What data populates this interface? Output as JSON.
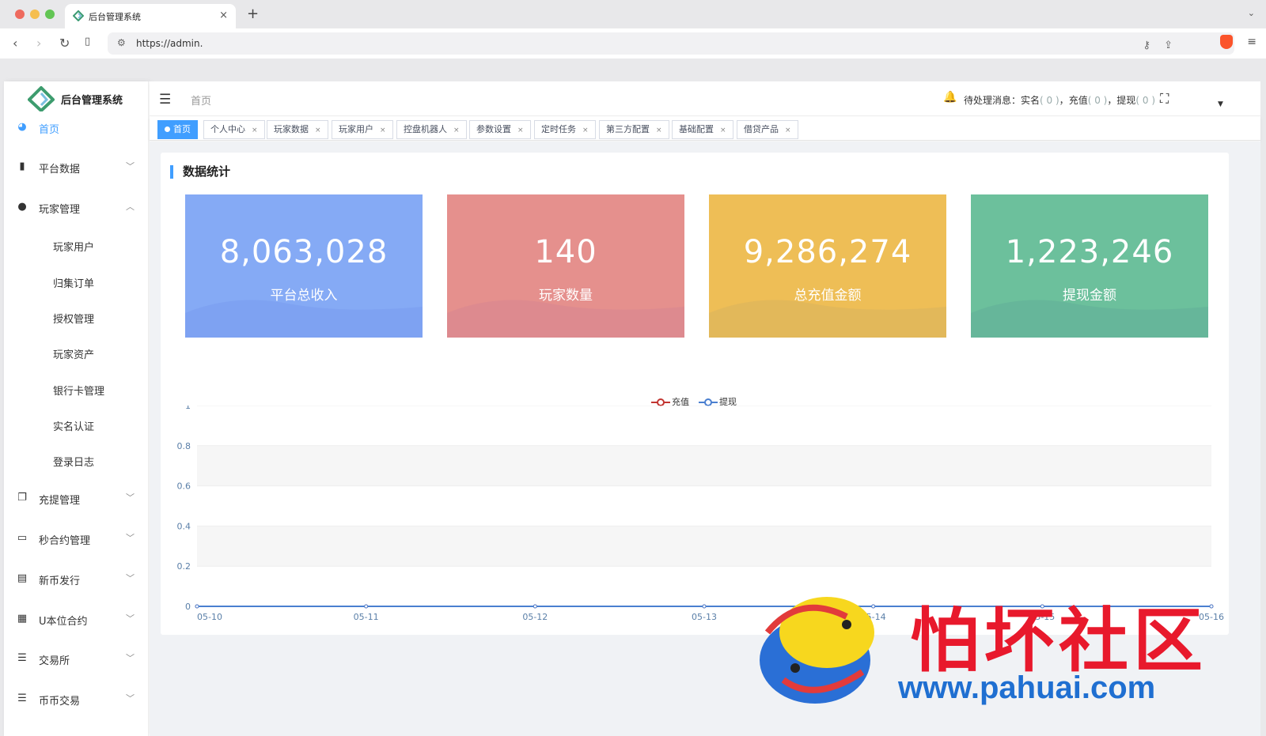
{
  "browser": {
    "tab_title": "后台管理系统",
    "new_tab_label": "+",
    "url": "https://admin."
  },
  "app": {
    "logo_text": "后台管理系统",
    "header": {
      "breadcrumb": "首页",
      "pending_label": "待处理消息：",
      "pending_items": [
        {
          "label": "实名",
          "count": "( 0 )",
          "sep": "，"
        },
        {
          "label": "充值",
          "count": "( 0 )",
          "sep": "，"
        },
        {
          "label": "提现",
          "count": "( 0 )",
          "sep": ""
        }
      ]
    },
    "sidebar": {
      "items": [
        {
          "label": "首页",
          "icon": "dashboard-icon",
          "active": true,
          "expandable": false
        },
        {
          "label": "平台数据",
          "icon": "book-icon",
          "expandable": true,
          "expanded": false
        },
        {
          "label": "玩家管理",
          "icon": "user-icon",
          "expandable": true,
          "expanded": true
        },
        {
          "label": "充提管理",
          "icon": "copy-icon",
          "expandable": true,
          "expanded": false
        },
        {
          "label": "秒合约管理",
          "icon": "monitor-icon",
          "expandable": true,
          "expanded": false
        },
        {
          "label": "新币发行",
          "icon": "newspaper-icon",
          "expandable": true,
          "expanded": false
        },
        {
          "label": "U本位合约",
          "icon": "grid-icon",
          "expandable": true,
          "expanded": false
        },
        {
          "label": "交易所",
          "icon": "list-tree-icon",
          "expandable": true,
          "expanded": false
        },
        {
          "label": "币币交易",
          "icon": "list-icon",
          "expandable": true,
          "expanded": false
        }
      ],
      "sub_items": [
        "玩家用户",
        "归集订单",
        "授权管理",
        "玩家资产",
        "银行卡管理",
        "实名认证",
        "登录日志"
      ]
    },
    "tags": [
      {
        "label": "首页",
        "active": true
      },
      {
        "label": "个人中心"
      },
      {
        "label": "玩家数据"
      },
      {
        "label": "玩家用户"
      },
      {
        "label": "控盘机器人"
      },
      {
        "label": "参数设置"
      },
      {
        "label": "定时任务"
      },
      {
        "label": "第三方配置"
      },
      {
        "label": "基础配置"
      },
      {
        "label": "借贷产品"
      }
    ],
    "section_title": "数据统计",
    "cards": [
      {
        "value": "8,063,028",
        "label": "平台总收入",
        "color": "#85aaf5",
        "wave": "#7c9ff0"
      },
      {
        "value": "140",
        "label": "玩家数量",
        "color": "#e5908d",
        "wave": "#d98890"
      },
      {
        "value": "9,286,274",
        "label": "总充值金额",
        "color": "#eebe56",
        "wave": "#ddb55c"
      },
      {
        "value": "1,223,246",
        "label": "提现金额",
        "color": "#6cc09c",
        "wave": "#64b39a"
      }
    ]
  },
  "chart_data": {
    "type": "line",
    "x": [
      "05-10",
      "05-11",
      "05-12",
      "05-13",
      "05-14",
      "05-15",
      "05-16"
    ],
    "series": [
      {
        "name": "充值",
        "values": [
          0,
          0,
          0,
          0,
          0,
          0,
          0
        ],
        "color": "#c23531"
      },
      {
        "name": "提现",
        "values": [
          0,
          0,
          0,
          0,
          0,
          0,
          0
        ],
        "color": "#4a7fd0"
      }
    ],
    "ylim": [
      0,
      1
    ],
    "yticks": [
      "0",
      "0.2",
      "0.4",
      "0.6",
      "0.8",
      "1"
    ],
    "grid": true,
    "legend": "top-center"
  },
  "watermark": {
    "text": "怕坏社区",
    "url": "www.pahuai.com"
  }
}
